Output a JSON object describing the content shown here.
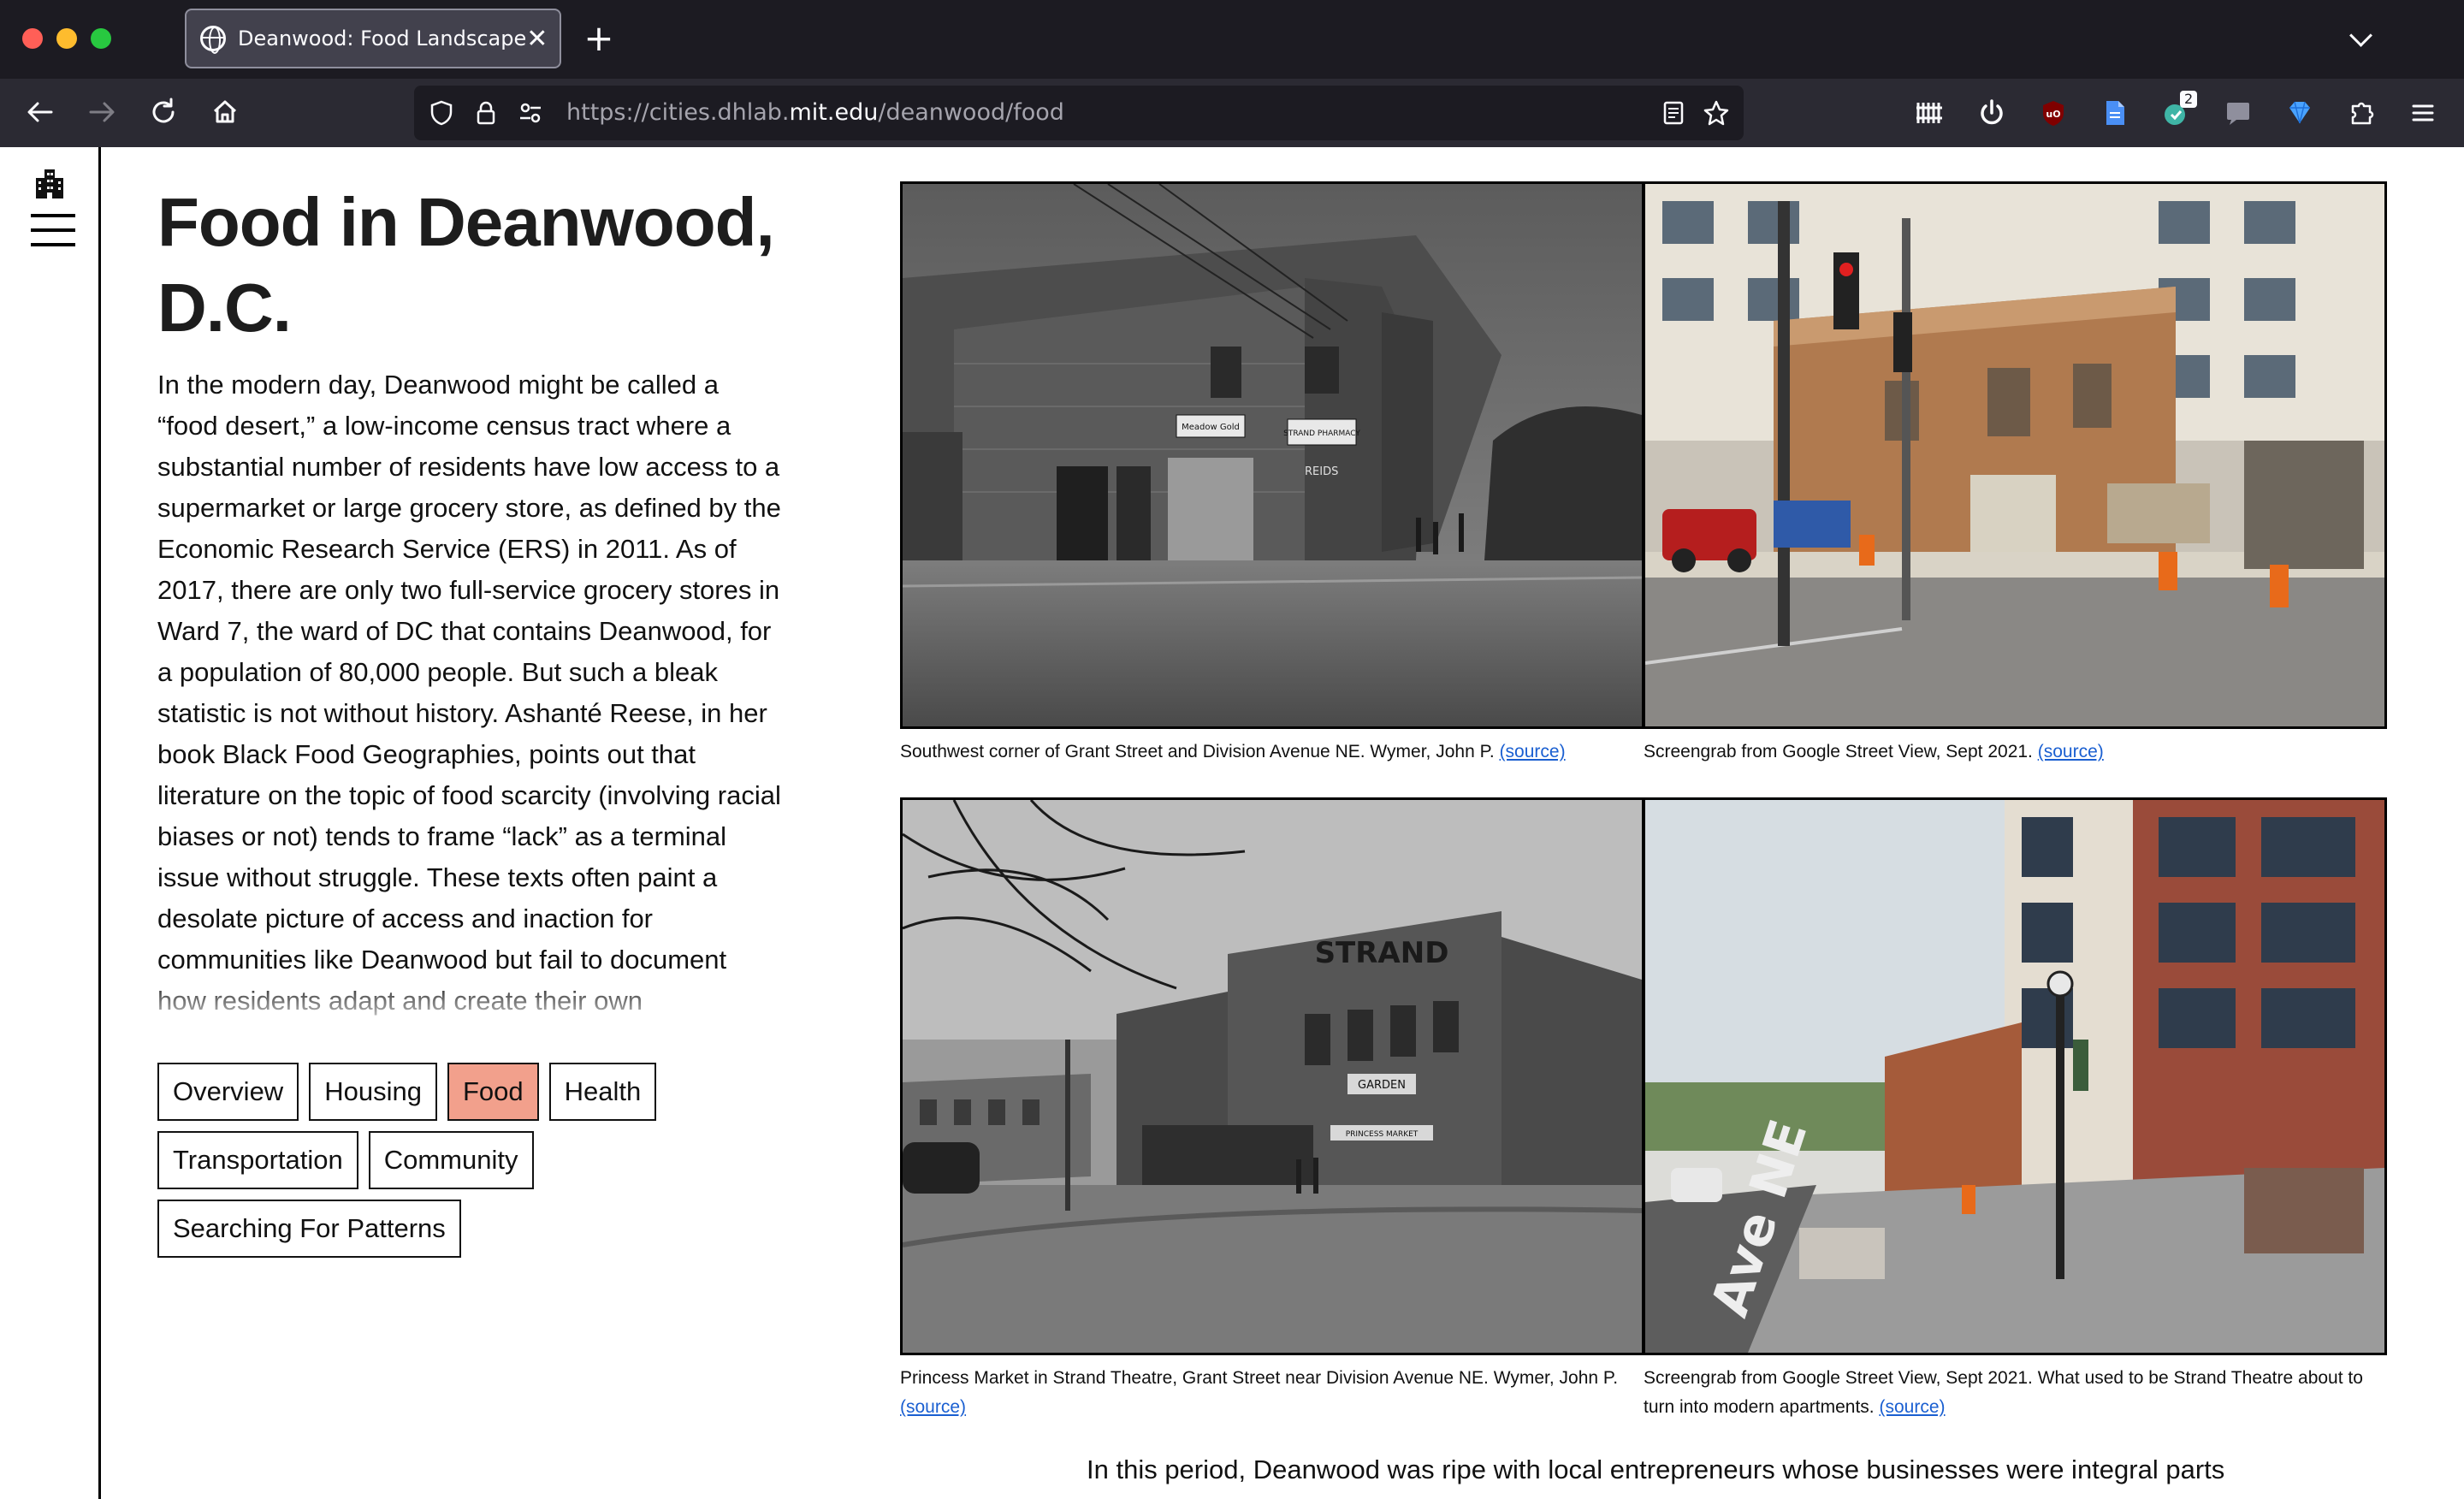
{
  "browser": {
    "tab_title": "Deanwood: Food Landscape",
    "tab_close": "✕",
    "new_tab": "+",
    "url_prefix": "https://cities.dhlab.",
    "url_domain": "mit.edu",
    "url_path": "/deanwood/food",
    "extension_badge": "2",
    "icons": [
      "back-icon",
      "forward-icon",
      "reload-icon",
      "home-icon",
      "shield-icon",
      "lock-icon",
      "permissions-icon",
      "reader-view-icon",
      "bookmark-star-icon",
      "library-icon",
      "power-icon",
      "ublock-icon",
      "document-icon",
      "extension-icon",
      "chat-icon",
      "gem-icon",
      "extensions-puzzle-icon",
      "menu-icon"
    ]
  },
  "page": {
    "title": "Food in Deanwood, D.C.",
    "intro": "In the modern day, Deanwood might be called a “food desert,” a low-income census tract where a substantial number of residents have low access to a supermarket or large grocery store, as defined by the Economic Research Service (ERS) in 2011. As of 2017, there are only two full-service grocery stores in Ward 7, the ward of DC that contains Deanwood, for a population of 80,000 people. But such a bleak statistic is not without history. Ashanté Reese, in her book Black Food Geographies, points out that literature on the topic of food scarcity (involving racial biases or not) tends to frame “lack” as a terminal issue without struggle. These texts often paint a desolate picture of access and inaction for communities like Deanwood but fail to document how residents adapt and create their own opportunities in response. Deanwood has a rich",
    "nav": {
      "overview": "Overview",
      "housing": "Housing",
      "food": "Food",
      "health": "Health",
      "transportation": "Transportation",
      "community": "Community",
      "patterns": "Searching For Patterns"
    },
    "active_tag_color": "#f2a08c",
    "photos": {
      "p1_caption": "Southwest corner of Grant Street and Division Avenue NE. Wymer, John P. ",
      "p2_caption": "Screengrab from Google Street View, Sept 2021. ",
      "p3_caption": "Princess Market in Strand Theatre, Grant Street near Division Avenue NE. Wymer, John P. ",
      "p4_caption": "Screengrab from Google Street View, Sept 2021. What used to be Strand Theatre about to turn into modern apartments. ",
      "source_link": "(source)",
      "sign_meadow_gold": "Meadow Gold",
      "sign_strand_pharmacy": "STRAND PHARMACY",
      "sign_reids": "REIDS",
      "sign_strand": "STRAND",
      "sign_garden": "GARDEN",
      "sign_princess_market": "PRINCESS MARKET",
      "street_text": "Ave NE"
    },
    "continuation": "In this period, Deanwood was ripe with local entrepreneurs whose businesses were integral parts"
  }
}
